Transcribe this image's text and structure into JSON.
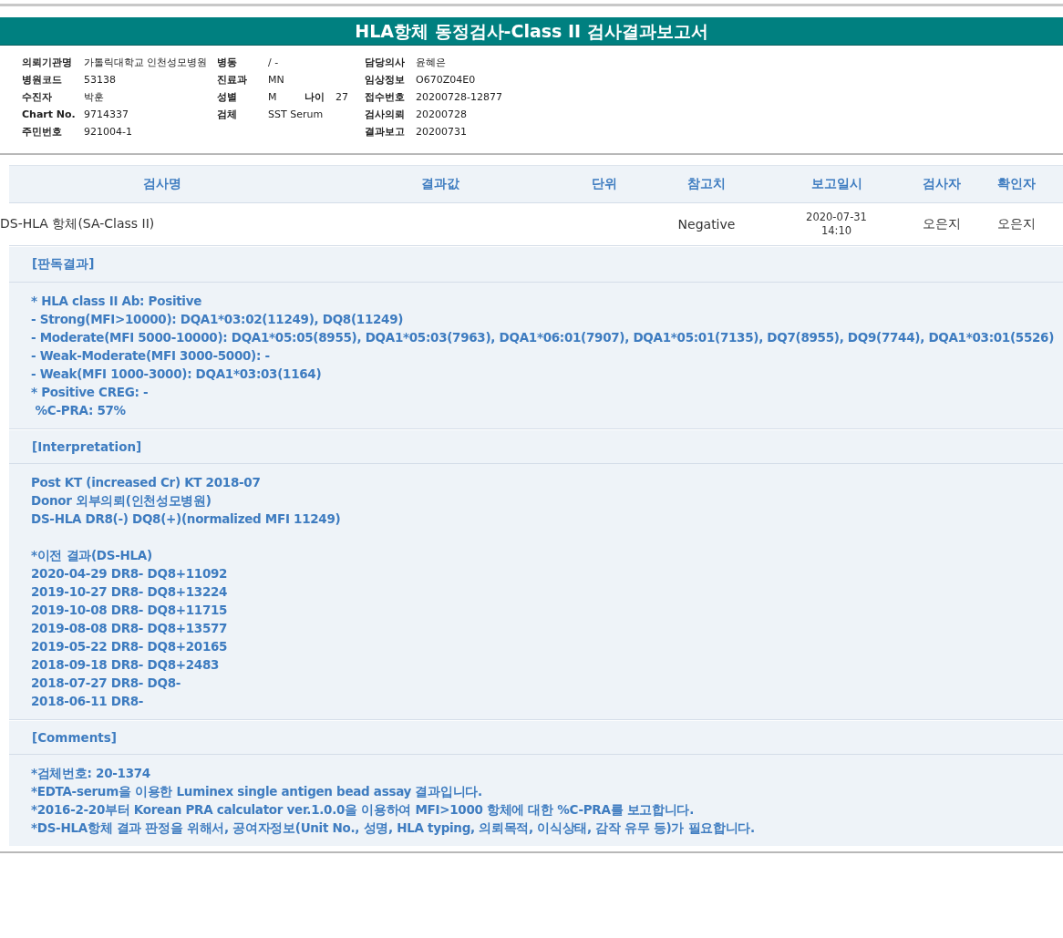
{
  "title": "HLA항체 동정검사-Class II 검사결과보고서",
  "info_rows": [
    {
      "left": {
        "label": "의뢰기관명",
        "value": "가톨릭대학교 인천성모병원"
      },
      "middle": {
        "label": "병동",
        "value": "/ -"
      },
      "right": {
        "label": "담당의사",
        "value": "윤혜은"
      }
    },
    {
      "left": {
        "label": "병원코드",
        "value": "53138"
      },
      "middle": {
        "label": "진료과",
        "value": "MN"
      },
      "right": {
        "label": "임상정보",
        "value": "O670Z04E0"
      }
    },
    {
      "left": {
        "label": "수진자",
        "value": "박훈"
      },
      "middle": {
        "label": "성별",
        "value": "M",
        "extra_label": "나이",
        "extra_value": "27"
      },
      "right": {
        "label": "접수번호",
        "value": "20200728-12877"
      }
    },
    {
      "left": {
        "label": "Chart No.",
        "value": "9714337"
      },
      "middle": {
        "label": "검체",
        "value": "SST Serum"
      },
      "right": {
        "label": "검사의뢰",
        "value": "20200728"
      }
    },
    {
      "left": {
        "label": "주민번호",
        "value": "921004-1"
      },
      "right": {
        "label": "결과보고",
        "value": "20200731"
      }
    }
  ],
  "table": {
    "columns": [
      "검사명",
      "결과값",
      "단위",
      "참고치",
      "보고일시",
      "검사자",
      "확인자"
    ],
    "rows": [
      {
        "test_name": "DS-HLA 항체(SA-Class II)",
        "reference": "Negative",
        "report_date": "2020-07-31",
        "report_time": "14:10",
        "tester": "오은지",
        "confirmer": "오은지"
      }
    ]
  },
  "sections": [
    {
      "heading": "[판독결과]",
      "paragraphs": [
        [
          "* HLA class II Ab: Positive",
          "- Strong(MFI>10000): DQA1*03:02(11249), DQ8(11249)",
          "- Moderate(MFI 5000-10000): DQA1*05:05(8955), DQA1*05:03(7963), DQA1*06:01(7907), DQA1*05:01(7135), DQ7(8955), DQ9(7744), DQA1*03:01(5526)",
          "- Weak-Moderate(MFI 3000-5000): -",
          "- Weak(MFI 1000-3000): DQA1*03:03(1164)",
          "* Positive CREG: -",
          " %C-PRA: 57%"
        ]
      ]
    },
    {
      "heading": "[Interpretation]",
      "paragraphs": [
        [
          "Post KT (increased Cr) KT 2018-07",
          "Donor 외부의뢰(인천성모병원)",
          "DS-HLA DR8(-) DQ8(+)(normalized MFI 11249)"
        ],
        [
          "*이전 결과(DS-HLA)",
          "2020-04-29 DR8- DQ8+11092",
          "2019-10-27 DR8- DQ8+13224",
          "2019-10-08 DR8- DQ8+11715",
          "2019-08-08 DR8- DQ8+13577",
          "2019-05-22 DR8- DQ8+20165",
          "2018-09-18 DR8- DQ8+2483",
          "2018-07-27 DR8- DQ8-",
          "2018-06-11 DR8-"
        ]
      ]
    },
    {
      "heading": "[Comments]",
      "paragraphs": [
        [
          "*검체번호: 20-1374",
          "*EDTA-serum을 이용한 Luminex single antigen bead assay 결과입니다.",
          "*2016-2-20부터 Korean PRA calculator ver.1.0.0을 이용하여 MFI>1000 항체에 대한 %C-PRA를 보고합니다.",
          "*DS-HLA항체 결과 판정을 위해서, 공여자정보(Unit No., 성명, HLA typing, 의뢰목적, 이식상태, 감작 유무 등)가 필요합니다."
        ]
      ]
    }
  ]
}
